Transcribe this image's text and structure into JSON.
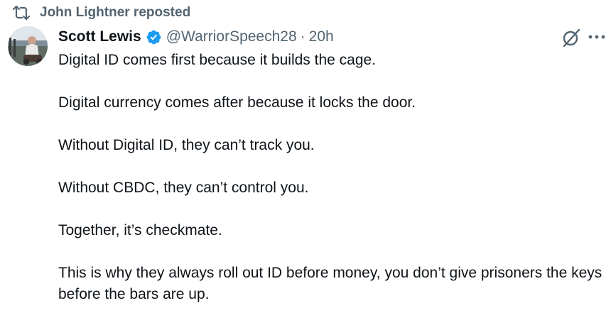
{
  "repost": {
    "icon": "repost-icon",
    "label": "John Lightner reposted"
  },
  "author": {
    "avatar_icon": "avatar-photo",
    "display_name": "Scott Lewis",
    "verified_icon": "verified-badge-icon",
    "verified_color": "#1d9bf0",
    "handle": "@WarriorSpeech28",
    "separator": "·",
    "time": "20h"
  },
  "actions": {
    "grok_icon": "grok-icon",
    "more_icon": "more-icon"
  },
  "tweet": {
    "paragraphs": [
      "Digital ID comes first because it builds the cage.",
      "Digital currency comes after because it locks the door.",
      "Without Digital ID, they can’t track you.",
      "Without CBDC, they can’t control you.",
      "Together, it’s checkmate.",
      "This is why they always roll out ID before money, you don’t give prisoners the keys before the bars are up."
    ]
  },
  "colors": {
    "text": "#0f1419",
    "secondary": "#536471",
    "accent": "#1d9bf0"
  }
}
